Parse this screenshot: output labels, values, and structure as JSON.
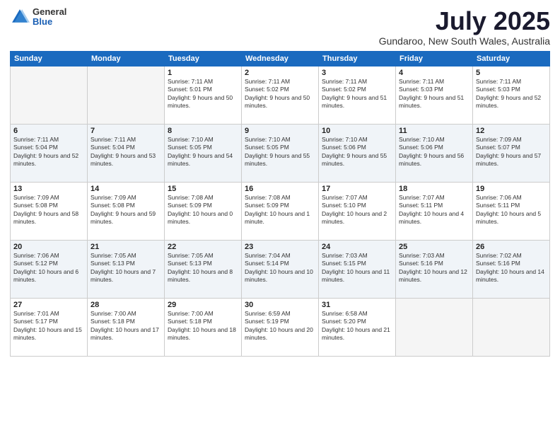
{
  "header": {
    "logo_general": "General",
    "logo_blue": "Blue",
    "month_title": "July 2025",
    "location": "Gundaroo, New South Wales, Australia"
  },
  "days_of_week": [
    "Sunday",
    "Monday",
    "Tuesday",
    "Wednesday",
    "Thursday",
    "Friday",
    "Saturday"
  ],
  "weeks": [
    [
      {
        "day": "",
        "sunrise": "",
        "sunset": "",
        "daylight": ""
      },
      {
        "day": "",
        "sunrise": "",
        "sunset": "",
        "daylight": ""
      },
      {
        "day": "1",
        "sunrise": "Sunrise: 7:11 AM",
        "sunset": "Sunset: 5:01 PM",
        "daylight": "Daylight: 9 hours and 50 minutes."
      },
      {
        "day": "2",
        "sunrise": "Sunrise: 7:11 AM",
        "sunset": "Sunset: 5:02 PM",
        "daylight": "Daylight: 9 hours and 50 minutes."
      },
      {
        "day": "3",
        "sunrise": "Sunrise: 7:11 AM",
        "sunset": "Sunset: 5:02 PM",
        "daylight": "Daylight: 9 hours and 51 minutes."
      },
      {
        "day": "4",
        "sunrise": "Sunrise: 7:11 AM",
        "sunset": "Sunset: 5:03 PM",
        "daylight": "Daylight: 9 hours and 51 minutes."
      },
      {
        "day": "5",
        "sunrise": "Sunrise: 7:11 AM",
        "sunset": "Sunset: 5:03 PM",
        "daylight": "Daylight: 9 hours and 52 minutes."
      }
    ],
    [
      {
        "day": "6",
        "sunrise": "Sunrise: 7:11 AM",
        "sunset": "Sunset: 5:04 PM",
        "daylight": "Daylight: 9 hours and 52 minutes."
      },
      {
        "day": "7",
        "sunrise": "Sunrise: 7:11 AM",
        "sunset": "Sunset: 5:04 PM",
        "daylight": "Daylight: 9 hours and 53 minutes."
      },
      {
        "day": "8",
        "sunrise": "Sunrise: 7:10 AM",
        "sunset": "Sunset: 5:05 PM",
        "daylight": "Daylight: 9 hours and 54 minutes."
      },
      {
        "day": "9",
        "sunrise": "Sunrise: 7:10 AM",
        "sunset": "Sunset: 5:05 PM",
        "daylight": "Daylight: 9 hours and 55 minutes."
      },
      {
        "day": "10",
        "sunrise": "Sunrise: 7:10 AM",
        "sunset": "Sunset: 5:06 PM",
        "daylight": "Daylight: 9 hours and 55 minutes."
      },
      {
        "day": "11",
        "sunrise": "Sunrise: 7:10 AM",
        "sunset": "Sunset: 5:06 PM",
        "daylight": "Daylight: 9 hours and 56 minutes."
      },
      {
        "day": "12",
        "sunrise": "Sunrise: 7:09 AM",
        "sunset": "Sunset: 5:07 PM",
        "daylight": "Daylight: 9 hours and 57 minutes."
      }
    ],
    [
      {
        "day": "13",
        "sunrise": "Sunrise: 7:09 AM",
        "sunset": "Sunset: 5:08 PM",
        "daylight": "Daylight: 9 hours and 58 minutes."
      },
      {
        "day": "14",
        "sunrise": "Sunrise: 7:09 AM",
        "sunset": "Sunset: 5:08 PM",
        "daylight": "Daylight: 9 hours and 59 minutes."
      },
      {
        "day": "15",
        "sunrise": "Sunrise: 7:08 AM",
        "sunset": "Sunset: 5:09 PM",
        "daylight": "Daylight: 10 hours and 0 minutes."
      },
      {
        "day": "16",
        "sunrise": "Sunrise: 7:08 AM",
        "sunset": "Sunset: 5:09 PM",
        "daylight": "Daylight: 10 hours and 1 minute."
      },
      {
        "day": "17",
        "sunrise": "Sunrise: 7:07 AM",
        "sunset": "Sunset: 5:10 PM",
        "daylight": "Daylight: 10 hours and 2 minutes."
      },
      {
        "day": "18",
        "sunrise": "Sunrise: 7:07 AM",
        "sunset": "Sunset: 5:11 PM",
        "daylight": "Daylight: 10 hours and 4 minutes."
      },
      {
        "day": "19",
        "sunrise": "Sunrise: 7:06 AM",
        "sunset": "Sunset: 5:11 PM",
        "daylight": "Daylight: 10 hours and 5 minutes."
      }
    ],
    [
      {
        "day": "20",
        "sunrise": "Sunrise: 7:06 AM",
        "sunset": "Sunset: 5:12 PM",
        "daylight": "Daylight: 10 hours and 6 minutes."
      },
      {
        "day": "21",
        "sunrise": "Sunrise: 7:05 AM",
        "sunset": "Sunset: 5:13 PM",
        "daylight": "Daylight: 10 hours and 7 minutes."
      },
      {
        "day": "22",
        "sunrise": "Sunrise: 7:05 AM",
        "sunset": "Sunset: 5:13 PM",
        "daylight": "Daylight: 10 hours and 8 minutes."
      },
      {
        "day": "23",
        "sunrise": "Sunrise: 7:04 AM",
        "sunset": "Sunset: 5:14 PM",
        "daylight": "Daylight: 10 hours and 10 minutes."
      },
      {
        "day": "24",
        "sunrise": "Sunrise: 7:03 AM",
        "sunset": "Sunset: 5:15 PM",
        "daylight": "Daylight: 10 hours and 11 minutes."
      },
      {
        "day": "25",
        "sunrise": "Sunrise: 7:03 AM",
        "sunset": "Sunset: 5:16 PM",
        "daylight": "Daylight: 10 hours and 12 minutes."
      },
      {
        "day": "26",
        "sunrise": "Sunrise: 7:02 AM",
        "sunset": "Sunset: 5:16 PM",
        "daylight": "Daylight: 10 hours and 14 minutes."
      }
    ],
    [
      {
        "day": "27",
        "sunrise": "Sunrise: 7:01 AM",
        "sunset": "Sunset: 5:17 PM",
        "daylight": "Daylight: 10 hours and 15 minutes."
      },
      {
        "day": "28",
        "sunrise": "Sunrise: 7:00 AM",
        "sunset": "Sunset: 5:18 PM",
        "daylight": "Daylight: 10 hours and 17 minutes."
      },
      {
        "day": "29",
        "sunrise": "Sunrise: 7:00 AM",
        "sunset": "Sunset: 5:18 PM",
        "daylight": "Daylight: 10 hours and 18 minutes."
      },
      {
        "day": "30",
        "sunrise": "Sunrise: 6:59 AM",
        "sunset": "Sunset: 5:19 PM",
        "daylight": "Daylight: 10 hours and 20 minutes."
      },
      {
        "day": "31",
        "sunrise": "Sunrise: 6:58 AM",
        "sunset": "Sunset: 5:20 PM",
        "daylight": "Daylight: 10 hours and 21 minutes."
      },
      {
        "day": "",
        "sunrise": "",
        "sunset": "",
        "daylight": ""
      },
      {
        "day": "",
        "sunrise": "",
        "sunset": "",
        "daylight": ""
      }
    ]
  ]
}
